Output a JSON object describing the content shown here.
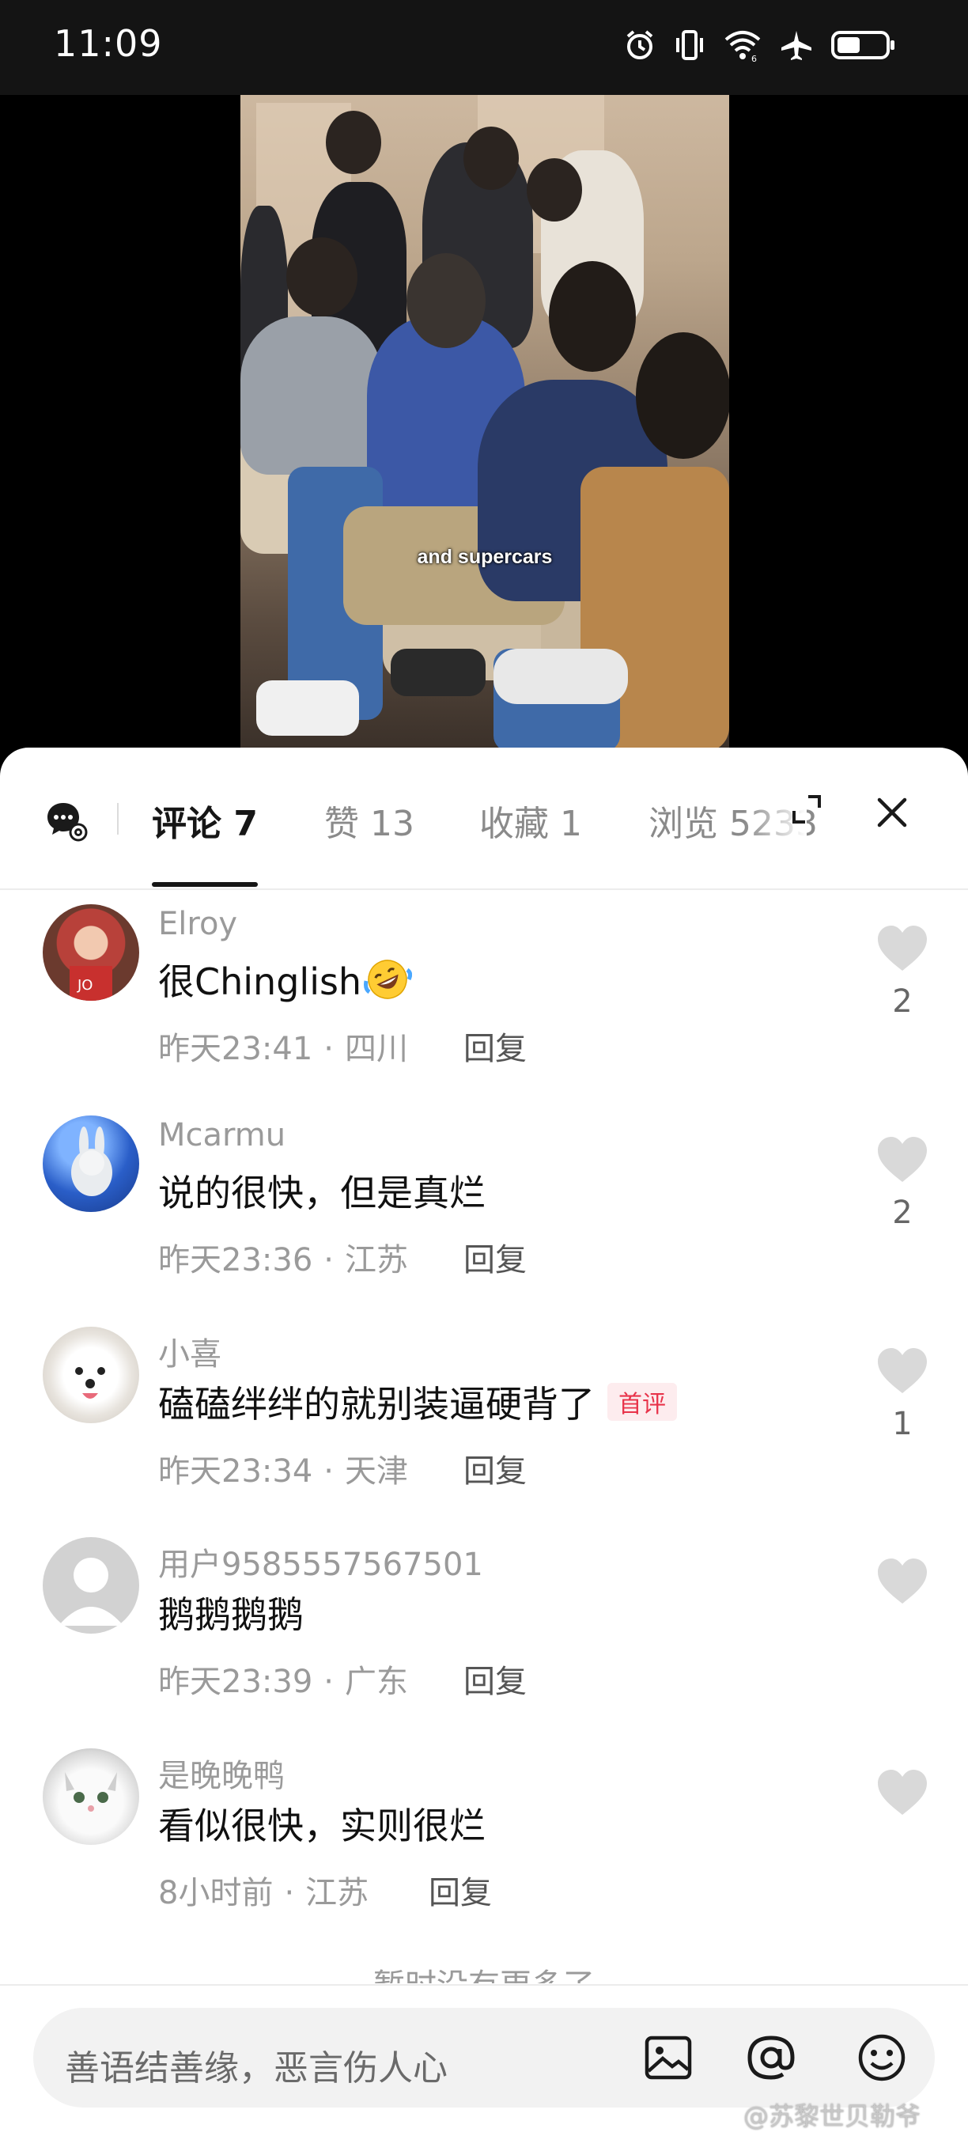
{
  "status_bar": {
    "time": "11:09",
    "icons": [
      "alarm-icon",
      "vibrate-icon",
      "wifi-icon",
      "airplane-icon",
      "battery-icon"
    ]
  },
  "video": {
    "caption": "and supercars"
  },
  "comments_sheet": {
    "tabs": [
      {
        "label": "评论 7",
        "active": true
      },
      {
        "label": "赞 13",
        "active": false
      },
      {
        "label": "收藏 1",
        "active": false
      },
      {
        "label": "浏览 5233",
        "active": false
      }
    ],
    "comments": [
      {
        "name": "Elroy",
        "text": "很Chinglish",
        "emoji": "rolling-laughing-emoji",
        "time": "昨天23:41",
        "location": "四川",
        "reply": "回复",
        "likes": "2",
        "badge": ""
      },
      {
        "name": "Mcarmu",
        "text": "说的很快，但是真烂",
        "time": "昨天23:36",
        "location": "江苏",
        "reply": "回复",
        "likes": "2",
        "badge": ""
      },
      {
        "name": "小喜",
        "text": "磕磕绊绊的就别装逼硬背了",
        "time": "昨天23:34",
        "location": "天津",
        "reply": "回复",
        "likes": "1",
        "badge": "首评"
      },
      {
        "name": "用户9585557567501",
        "text": "鹅鹅鹅鹅",
        "time": "昨天23:39",
        "location": "广东",
        "reply": "回复",
        "likes": "",
        "badge": ""
      },
      {
        "name": "是晚晚鸭",
        "text": "看似很快，实则很烂",
        "time": "8小时前",
        "location": "江苏",
        "reply": "回复",
        "likes": "",
        "badge": ""
      }
    ],
    "no_more": "暂时没有更多了",
    "meta_separator": "·"
  },
  "input_bar": {
    "placeholder": "善语结善缘，恶言伤人心",
    "icons": [
      "image-icon",
      "at-icon",
      "emoji-icon"
    ]
  },
  "watermark": "@苏黎世贝勒爷",
  "colors": {
    "accent_badge": "#e8334a",
    "badge_bg": "#fdecee",
    "status_bar_bg": "#141414"
  }
}
